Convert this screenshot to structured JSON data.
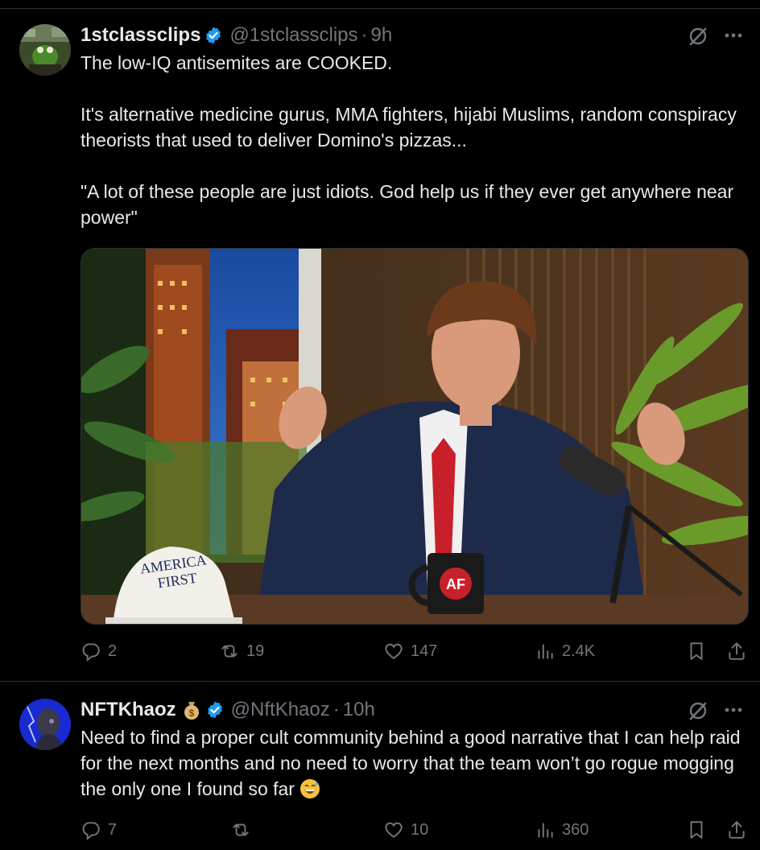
{
  "tweets": [
    {
      "display_name": "1stclassclips",
      "handle": "@1stclassclips",
      "time": "9h",
      "paragraphs": [
        "The low-IQ antisemites are COOKED.",
        "It's alternative medicine gurus, MMA fighters, hijabi Muslims, random conspiracy theorists that used to deliver Domino's pizzas...",
        "\"A lot of these people are just idiots. God help us if they ever get anywhere near power\""
      ],
      "media": {
        "hat_line1": "AMERICA",
        "hat_line2": "FIRST",
        "mug_text": "AF"
      },
      "stats": {
        "replies": "2",
        "reposts": "19",
        "likes": "147",
        "views": "2.4K"
      }
    },
    {
      "display_name": "NFTKhaoz",
      "badge_emoji": "money-bag",
      "handle": "@NftKhaoz",
      "time": "10h",
      "paragraphs": [
        "Need to find a proper cult community behind a good narrative that I can help raid for the next months and no need to worry that the team won’t go rogue mogging the only one I found so far"
      ],
      "trailing_emoji": "grinning-sweat-face",
      "stats": {
        "replies": "7",
        "reposts": "",
        "likes": "10",
        "views": "360"
      }
    }
  ],
  "separator": "·",
  "colors": {
    "background": "#000000",
    "text": "#e7e9ea",
    "muted": "#71767b",
    "verified": "#1d9bf0",
    "divider": "#2f3336"
  }
}
